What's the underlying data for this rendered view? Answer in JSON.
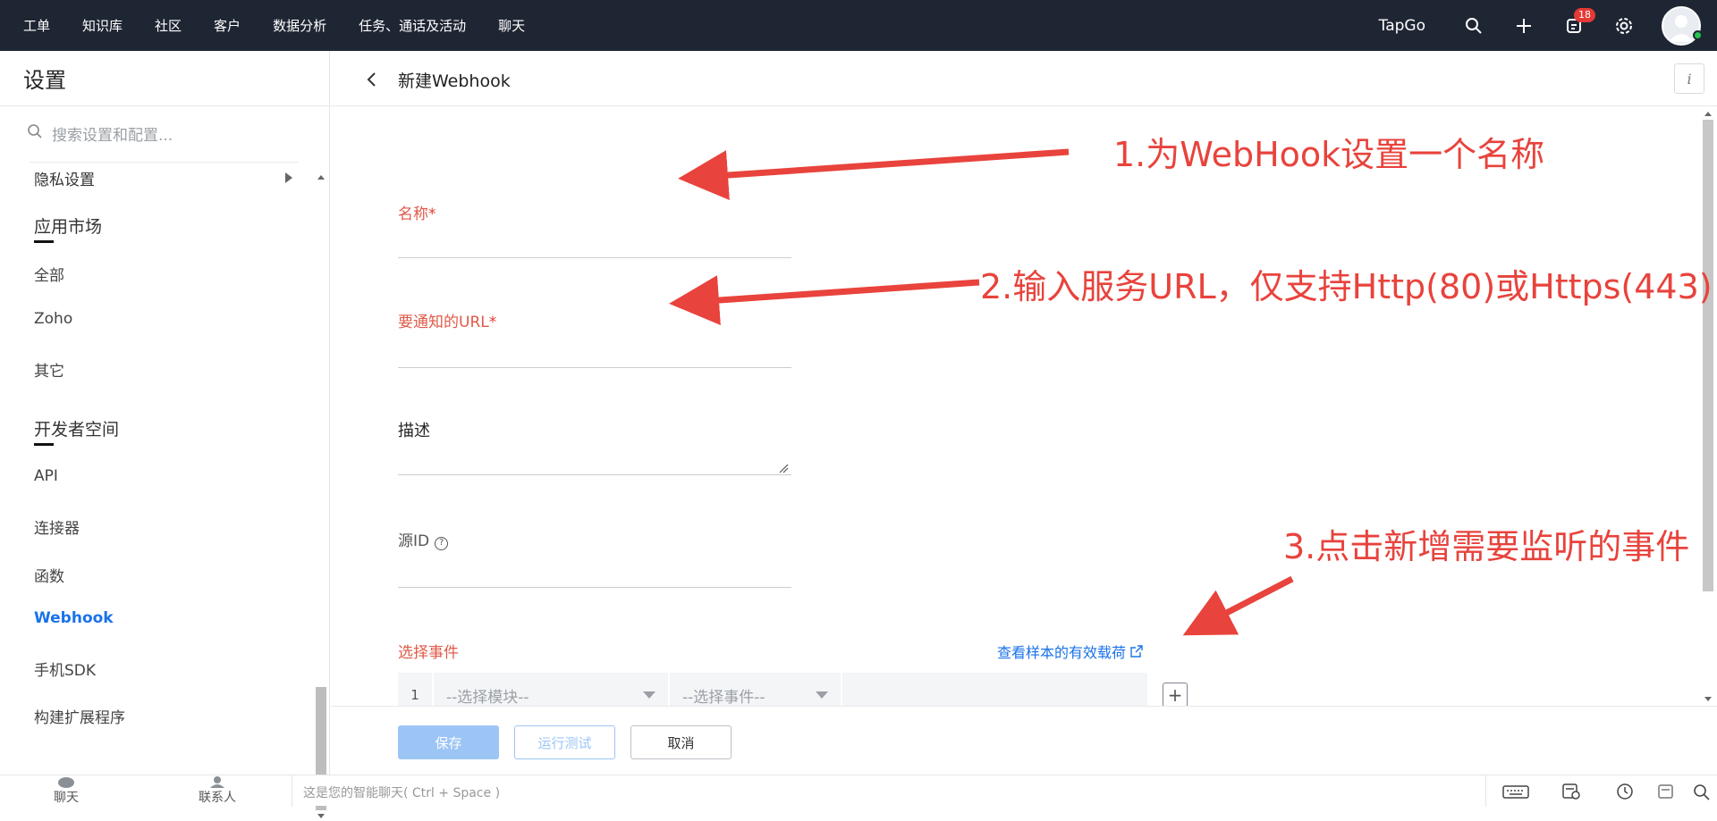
{
  "topbar": {
    "nav": [
      "工单",
      "知识库",
      "社区",
      "客户",
      "数据分析",
      "任务、通话及活动",
      "聊天"
    ],
    "brand": "TapGo",
    "notification_count": "18"
  },
  "sidebar": {
    "title": "设置",
    "search_placeholder": "搜索设置和配置...",
    "privacy": "隐私设置",
    "marketplace": {
      "heading": "应用市场",
      "items": [
        "全部",
        "Zoho",
        "其它"
      ]
    },
    "developer": {
      "heading": "开发者空间",
      "items": [
        "API",
        "连接器",
        "函数",
        "Webhook",
        "手机SDK",
        "构建扩展程序"
      ]
    }
  },
  "main": {
    "title": "新建Webhook",
    "info_label": "i",
    "fields": {
      "name_label": "名称",
      "url_label": "要通知的URL",
      "required_mark": "*",
      "description_label": "描述",
      "source_id_label": "源ID",
      "help_mark": "?"
    },
    "events": {
      "label": "选择事件",
      "sample_link": "查看样本的有效载荷",
      "row_number": "1",
      "module_placeholder": "--选择模块--",
      "event_placeholder": "--选择事件--",
      "add_label": "+"
    },
    "footer": {
      "save": "保存",
      "test": "运行测试",
      "cancel": "取消"
    }
  },
  "bottombar": {
    "chat": "聊天",
    "contacts": "联系人",
    "smart_chat_placeholder": "这是您的智能聊天( Ctrl + Space )"
  },
  "annotations": {
    "step1": "1.为WebHook设置一个名称",
    "step2": "2.输入服务URL，仅支持Http(80)或Https(443)",
    "step3": "3.点击新增需要监听的事件",
    "color": "#e8433c"
  }
}
